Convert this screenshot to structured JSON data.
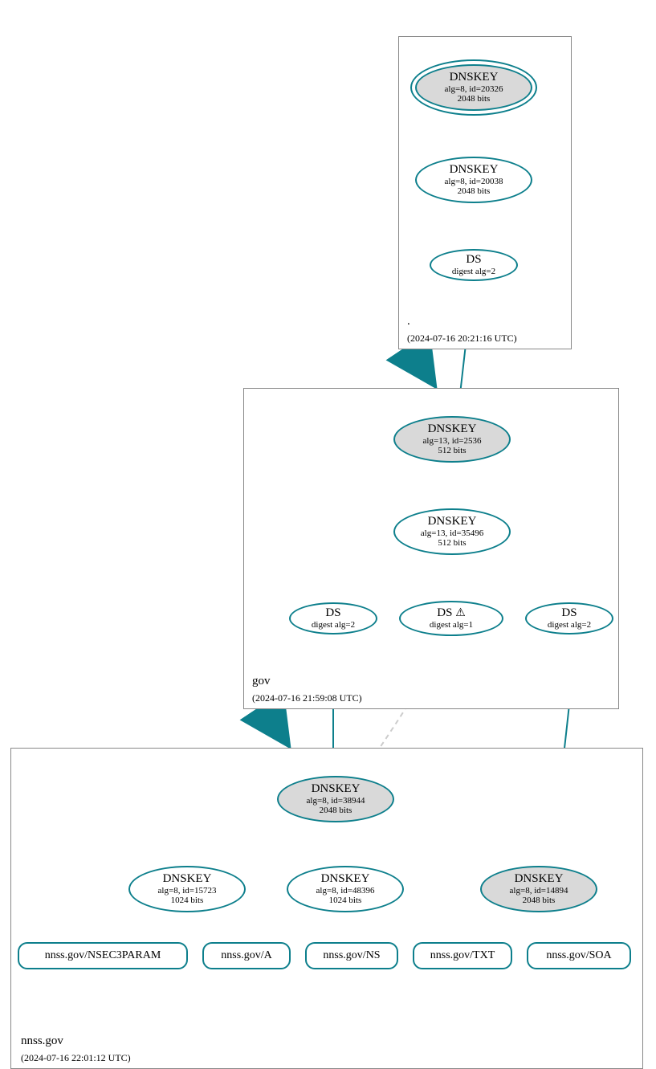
{
  "zones": {
    "root": {
      "name": ".",
      "timestamp": "(2024-07-16 20:21:16 UTC)"
    },
    "gov": {
      "name": "gov",
      "timestamp": "(2024-07-16 21:59:08 UTC)"
    },
    "nnss": {
      "name": "nnss.gov",
      "timestamp": "(2024-07-16 22:01:12 UTC)"
    }
  },
  "nodes": {
    "root_ksk": {
      "title": "DNSKEY",
      "line2": "alg=8, id=20326",
      "line3": "2048 bits"
    },
    "root_zsk": {
      "title": "DNSKEY",
      "line2": "alg=8, id=20038",
      "line3": "2048 bits"
    },
    "root_ds": {
      "title": "DS",
      "line2": "digest alg=2"
    },
    "gov_ksk": {
      "title": "DNSKEY",
      "line2": "alg=13, id=2536",
      "line3": "512 bits"
    },
    "gov_zsk": {
      "title": "DNSKEY",
      "line2": "alg=13, id=35496",
      "line3": "512 bits"
    },
    "gov_ds1": {
      "title": "DS",
      "line2": "digest alg=2"
    },
    "gov_ds2": {
      "title": "DS",
      "line2": "digest alg=1",
      "warn": "⚠"
    },
    "gov_ds3": {
      "title": "DS",
      "line2": "digest alg=2"
    },
    "nnss_ksk": {
      "title": "DNSKEY",
      "line2": "alg=8, id=38944",
      "line3": "2048 bits"
    },
    "nnss_zsk1": {
      "title": "DNSKEY",
      "line2": "alg=8, id=15723",
      "line3": "1024 bits"
    },
    "nnss_zsk2": {
      "title": "DNSKEY",
      "line2": "alg=8, id=48396",
      "line3": "1024 bits"
    },
    "nnss_key14894": {
      "title": "DNSKEY",
      "line2": "alg=8, id=14894",
      "line3": "2048 bits"
    },
    "rr_nsec3": {
      "label": "nnss.gov/NSEC3PARAM"
    },
    "rr_a": {
      "label": "nnss.gov/A"
    },
    "rr_ns": {
      "label": "nnss.gov/NS"
    },
    "rr_txt": {
      "label": "nnss.gov/TXT"
    },
    "rr_soa": {
      "label": "nnss.gov/SOA"
    }
  }
}
